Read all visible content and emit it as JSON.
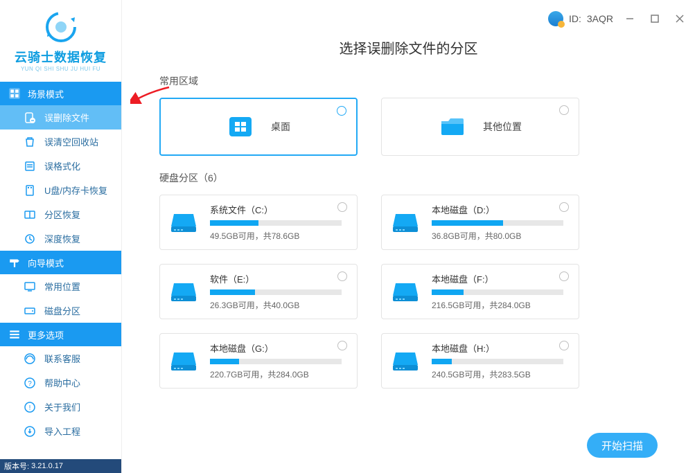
{
  "logo": {
    "title": "云骑士数据恢复",
    "subtitle": "YUN QI SHI SHU JU HUI FU"
  },
  "titlebar": {
    "id_prefix": "ID:",
    "id_value": "3AQR"
  },
  "sidebar": {
    "sections": [
      {
        "header": "场景模式",
        "items": [
          {
            "label": "误删除文件",
            "active": true
          },
          {
            "label": "误清空回收站"
          },
          {
            "label": "误格式化"
          },
          {
            "label": "U盘/内存卡恢复"
          },
          {
            "label": "分区恢复"
          },
          {
            "label": "深度恢复"
          }
        ]
      },
      {
        "header": "向导模式",
        "items": [
          {
            "label": "常用位置"
          },
          {
            "label": "磁盘分区"
          }
        ]
      },
      {
        "header": "更多选项",
        "items": [
          {
            "label": "联系客服"
          },
          {
            "label": "帮助中心"
          },
          {
            "label": "关于我们"
          },
          {
            "label": "导入工程"
          }
        ]
      }
    ],
    "version_label": "版本号:",
    "version_value": "3.21.0.17"
  },
  "main": {
    "title": "选择误删除文件的分区",
    "common_label": "常用区域",
    "locations": [
      {
        "label": "桌面",
        "selected": true,
        "icon": "windows"
      },
      {
        "label": "其他位置",
        "selected": false,
        "icon": "folder"
      }
    ],
    "drives_label": "硬盘分区（6）",
    "drives": [
      {
        "name": "系统文件（C:）",
        "free": "49.5GB",
        "total": "78.6GB",
        "used_pct": 37
      },
      {
        "name": "本地磁盘（D:）",
        "free": "36.8GB",
        "total": "80.0GB",
        "used_pct": 54
      },
      {
        "name": "软件（E:）",
        "free": "26.3GB",
        "total": "40.0GB",
        "used_pct": 34
      },
      {
        "name": "本地磁盘（F:）",
        "free": "216.5GB",
        "total": "284.0GB",
        "used_pct": 24
      },
      {
        "name": "本地磁盘（G:）",
        "free": "220.7GB",
        "total": "284.0GB",
        "used_pct": 22
      },
      {
        "name": "本地磁盘（H:）",
        "free": "240.5GB",
        "total": "283.5GB",
        "used_pct": 15
      }
    ],
    "meta_template_mid": "可用，共",
    "scan_button": "开始扫描"
  }
}
